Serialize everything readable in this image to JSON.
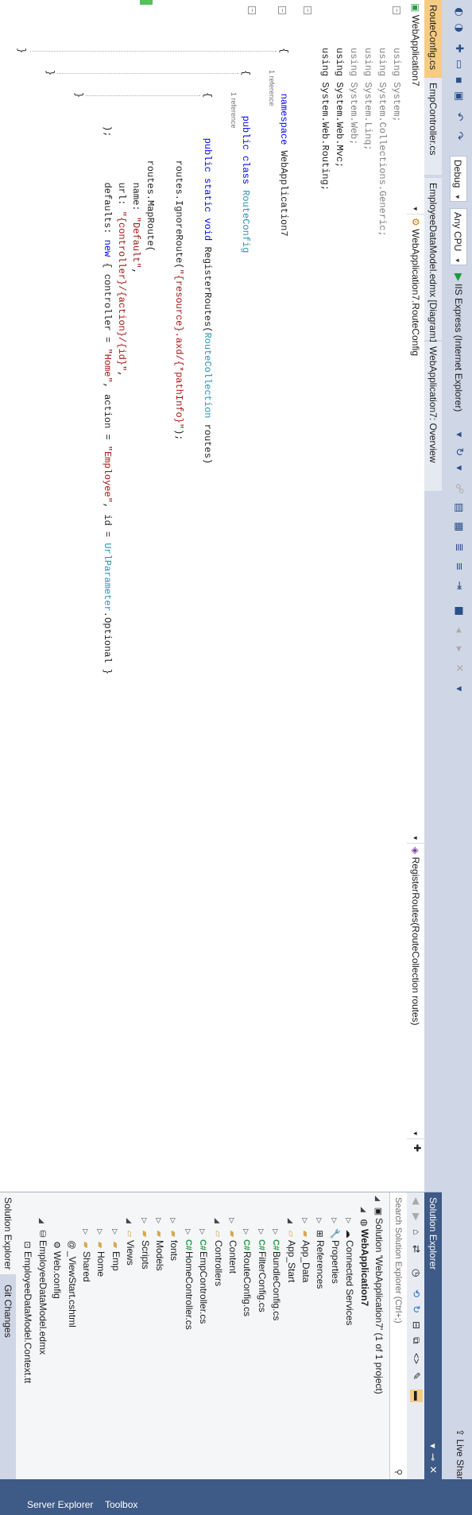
{
  "toolbar": {
    "config": "Debug",
    "platform": "Any CPU",
    "run_target": "IIS Express (Internet Explorer)",
    "live_share": "Live Share"
  },
  "tabs": [
    {
      "label": "RouteConfig.cs",
      "active": true
    },
    {
      "label": "EmpController.cs",
      "active": false
    },
    {
      "label": "EmployeeDataModel.edmx [Diagram1]",
      "active": false
    },
    {
      "label": "WebApplication7: Overview",
      "active": false
    }
  ],
  "navbar": {
    "project": "WebApplication7",
    "class": "WebApplication7.RouteConfig",
    "member": "RegisterRoutes(RouteCollection routes)"
  },
  "code": {
    "usings": [
      "using System;",
      "using System.Collections.Generic;",
      "using System.Linq;",
      "using System.Web;",
      "using System.Web.Mvc;",
      "using System.Web.Routing;"
    ],
    "ns_kw": "namespace",
    "ns_name": "WebApplication7",
    "ref_count_1": "1 reference",
    "class_line_kw": "public class",
    "class_name": "RouteConfig",
    "ref_count_2": "1 reference",
    "method_kw": "public static void",
    "method_name": "RegisterRoutes(",
    "method_param_type": "RouteCollection",
    "method_param": " routes)",
    "ignore_prefix": "routes.",
    "ignore_method": "IgnoreRoute",
    "ignore_arg": "\"{resource}.axd/{*pathInfo}\"",
    "ignore_end": ");",
    "maproute_prefix": "routes.",
    "maproute_method": "MapRoute",
    "maproute_end": "(",
    "name_label": "name: ",
    "name_value": "\"Default\"",
    "url_label": "url: ",
    "url_value": "\"{controller}/{action}/{id}\"",
    "defaults_label": "defaults: ",
    "defaults_new": "new",
    "defaults_mid1": " { controller = ",
    "defaults_home": "\"Home\"",
    "defaults_mid2": ", action = ",
    "defaults_emp": "\"Employee\"",
    "defaults_mid3": ", id = ",
    "defaults_type": "UrlParameter",
    "defaults_end": ".Optional }",
    "close_paren": ");"
  },
  "solution_explorer": {
    "title": "Solution Explorer",
    "search_placeholder": "Search Solution Explorer (Ctrl+;)",
    "tree": [
      {
        "label": "Solution 'WebApplication7' (1 of 1 project)",
        "level": 0,
        "icon": "solution-icon"
      },
      {
        "label": "WebApplication7",
        "level": 1,
        "icon": "web-project-icon",
        "bold": true
      },
      {
        "label": "Connected Services",
        "level": 2,
        "icon": "connected-services-icon"
      },
      {
        "label": "Properties",
        "level": 2,
        "icon": "wrench-icon"
      },
      {
        "label": "References",
        "level": 2,
        "icon": "references-icon"
      },
      {
        "label": "App_Data",
        "level": 2,
        "icon": "folder-icon"
      },
      {
        "label": "App_Start",
        "level": 2,
        "icon": "folder-open-icon"
      },
      {
        "label": "BundleConfig.cs",
        "level": 3,
        "icon": "csharp-icon"
      },
      {
        "label": "FilterConfig.cs",
        "level": 3,
        "icon": "csharp-icon"
      },
      {
        "label": "RouteConfig.cs",
        "level": 3,
        "icon": "csharp-icon"
      },
      {
        "label": "Content",
        "level": 2,
        "icon": "folder-icon"
      },
      {
        "label": "Controllers",
        "level": 2,
        "icon": "folder-open-icon"
      },
      {
        "label": "EmpController.cs",
        "level": 3,
        "icon": "csharp-icon"
      },
      {
        "label": "HomeController.cs",
        "level": 3,
        "icon": "csharp-icon"
      },
      {
        "label": "fonts",
        "level": 2,
        "icon": "folder-icon"
      },
      {
        "label": "Models",
        "level": 2,
        "icon": "folder-icon"
      },
      {
        "label": "Scripts",
        "level": 2,
        "icon": "folder-icon"
      },
      {
        "label": "Views",
        "level": 2,
        "icon": "folder-open-icon"
      },
      {
        "label": "Emp",
        "level": 3,
        "icon": "folder-icon"
      },
      {
        "label": "Home",
        "level": 3,
        "icon": "folder-icon"
      },
      {
        "label": "Shared",
        "level": 3,
        "icon": "folder-icon"
      },
      {
        "label": "_ViewStart.cshtml",
        "level": 3,
        "icon": "razor-icon"
      },
      {
        "label": "Web.config",
        "level": 3,
        "icon": "config-icon"
      },
      {
        "label": "EmployeeDataModel.edmx",
        "level": 2,
        "icon": "edmx-icon"
      },
      {
        "label": "EmployeeDataModel.Context.tt",
        "level": 3,
        "icon": "tt-icon"
      }
    ],
    "bottom_tabs": [
      "Solution Explorer",
      "Git Changes"
    ]
  },
  "side_tabs": [
    "Server Explorer",
    "Toolbox"
  ]
}
